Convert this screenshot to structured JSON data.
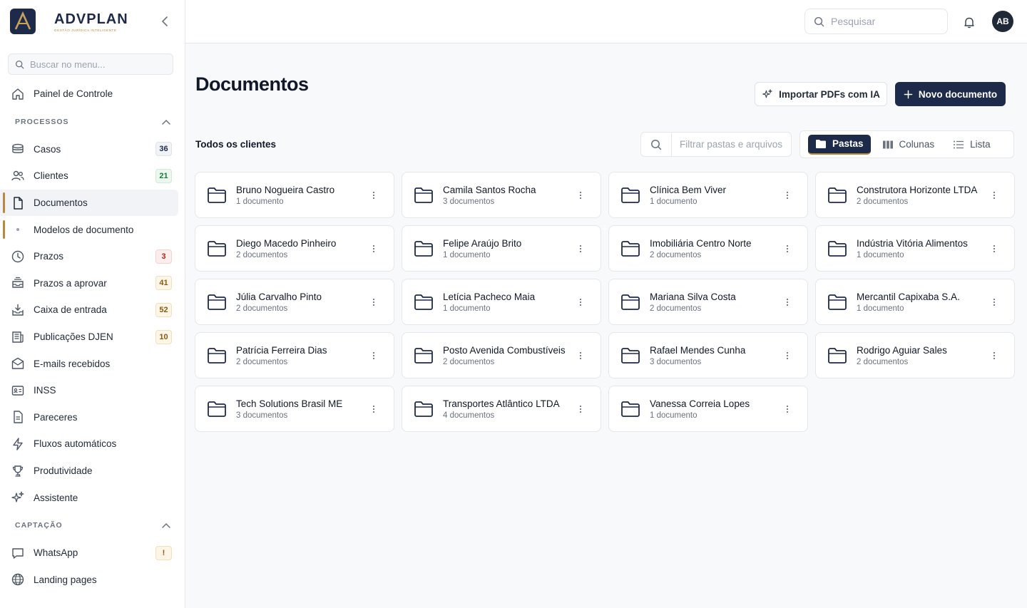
{
  "brand": {
    "name": "ADVPLAN",
    "tagline": "GESTÃO JURÍDICA INTELIGENTE",
    "logo_letter": "A"
  },
  "sidebar": {
    "search_placeholder": "Buscar no menu...",
    "top_items": [
      {
        "label": "Painel de Controle",
        "icon": "home-icon"
      }
    ],
    "sections": [
      {
        "title": "PROCESSOS"
      },
      {
        "title": "CAPTAÇÃO"
      }
    ],
    "processos": [
      {
        "label": "Casos",
        "badge": "36"
      },
      {
        "label": "Clientes",
        "badge": "21"
      },
      {
        "label": "Documentos"
      },
      {
        "label": "Modelos de documento"
      },
      {
        "label": "Prazos",
        "badge": "3"
      },
      {
        "label": "Prazos a aprovar",
        "badge": "41"
      },
      {
        "label": "Caixa de entrada",
        "badge": "52"
      },
      {
        "label": "Publicações DJEN",
        "badge": "10"
      },
      {
        "label": "E-mails recebidos"
      },
      {
        "label": "INSS"
      },
      {
        "label": "Pareceres"
      },
      {
        "label": "Fluxos automáticos"
      },
      {
        "label": "Produtividade"
      },
      {
        "label": "Assistente"
      }
    ],
    "captacao": [
      {
        "label": "WhatsApp",
        "badge": "!"
      },
      {
        "label": "Landing pages"
      }
    ]
  },
  "topbar": {
    "search_placeholder": "Pesquisar",
    "avatar_initials": "AB"
  },
  "main": {
    "title": "Documentos",
    "import_label": "Importar PDFs com IA",
    "new_label": "Novo documento",
    "scope": "Todos os clientes",
    "filter_placeholder": "Filtrar pastas e arquivos",
    "views": [
      "Pastas",
      "Colunas",
      "Lista"
    ],
    "active_view": "Pastas",
    "folders": [
      {
        "name": "Bruno Nogueira Castro",
        "count": "1 documento"
      },
      {
        "name": "Camila Santos Rocha",
        "count": "3 documentos"
      },
      {
        "name": "Clínica Bem Viver",
        "count": "1 documento"
      },
      {
        "name": "Construtora Horizonte LTDA",
        "count": "2 documentos"
      },
      {
        "name": "Diego Macedo Pinheiro",
        "count": "2 documentos"
      },
      {
        "name": "Felipe Araújo Brito",
        "count": "1 documento"
      },
      {
        "name": "Imobiliária Centro Norte",
        "count": "2 documentos"
      },
      {
        "name": "Indústria Vitória Alimentos",
        "count": "1 documento"
      },
      {
        "name": "Júlia Carvalho Pinto",
        "count": "2 documentos"
      },
      {
        "name": "Letícia Pacheco Maia",
        "count": "1 documento"
      },
      {
        "name": "Mariana Silva Costa",
        "count": "2 documentos"
      },
      {
        "name": "Mercantil Capixaba S.A.",
        "count": "1 documento"
      },
      {
        "name": "Patrícia Ferreira Dias",
        "count": "2 documentos"
      },
      {
        "name": "Posto Avenida Combustíveis",
        "count": "2 documentos"
      },
      {
        "name": "Rafael Mendes Cunha",
        "count": "3 documentos"
      },
      {
        "name": "Rodrigo Aguiar Sales",
        "count": "2 documentos"
      },
      {
        "name": "Tech Solutions Brasil ME",
        "count": "3 documentos"
      },
      {
        "name": "Transportes Atlântico LTDA",
        "count": "4 documentos"
      },
      {
        "name": "Vanessa Correia Lopes",
        "count": "1 documento"
      }
    ]
  },
  "colors": {
    "navy": "#1e2a4a",
    "gold": "#b8893a"
  }
}
